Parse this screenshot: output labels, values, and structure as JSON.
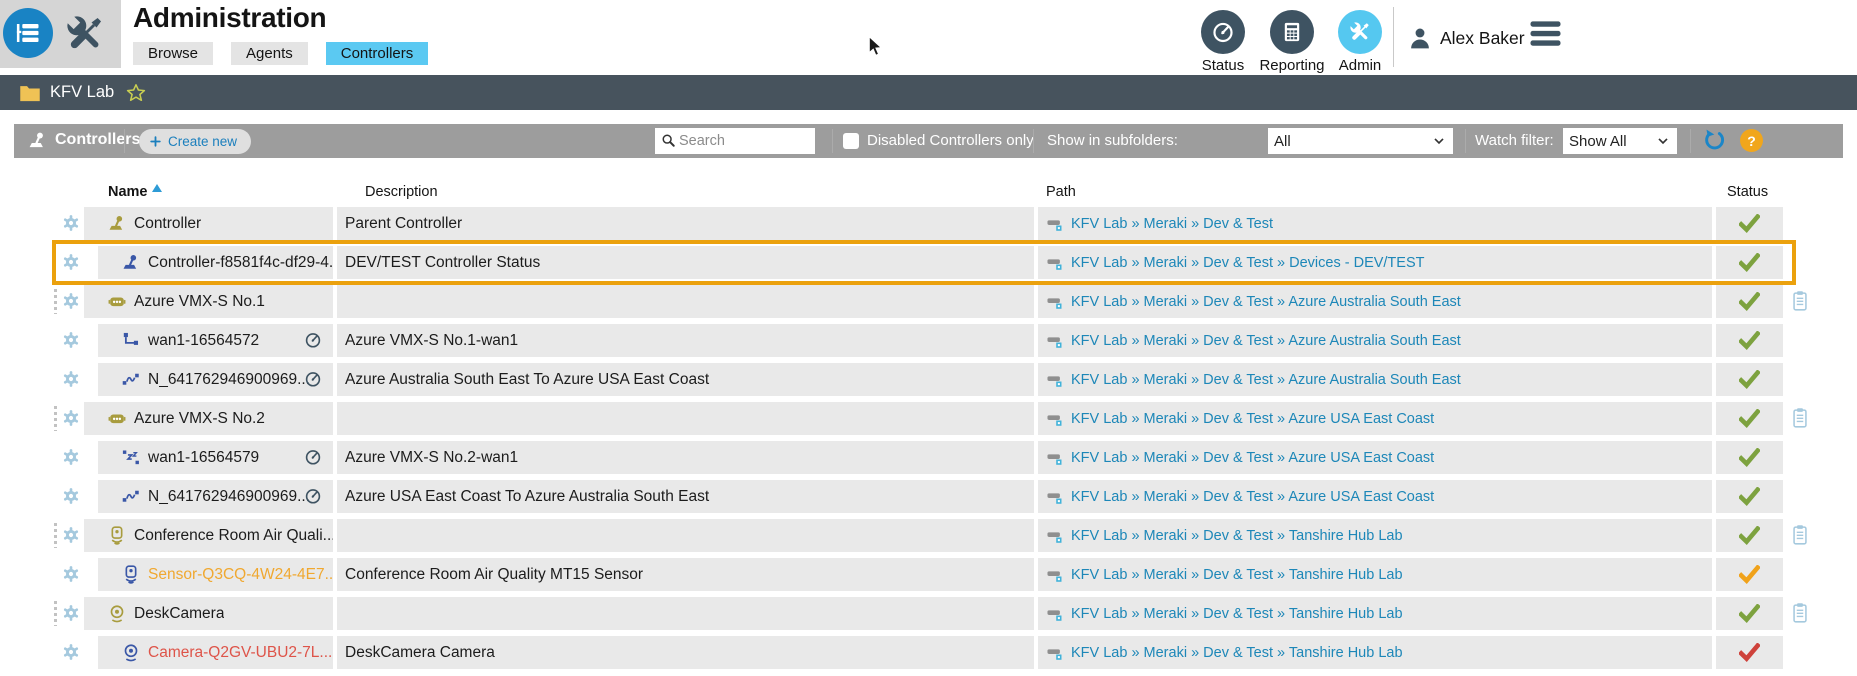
{
  "header": {
    "title": "Administration",
    "tabs": [
      {
        "label": "Browse",
        "active": false
      },
      {
        "label": "Agents",
        "active": false
      },
      {
        "label": "Controllers",
        "active": true
      }
    ],
    "nav": [
      {
        "label": "Status",
        "icon": "gauge",
        "active": false
      },
      {
        "label": "Reporting",
        "icon": "calculator",
        "active": false
      },
      {
        "label": "Admin",
        "icon": "tools",
        "active": true
      }
    ],
    "user_name": "Alex Baker"
  },
  "breadcrumb": {
    "folder_label": "KFV Lab"
  },
  "toolbar": {
    "section_label": "Controllers",
    "create_label": "Create new",
    "search_placeholder": "Search",
    "disabled_only_label": "Disabled Controllers only",
    "disabled_only_checked": false,
    "subfolders_label": "Show in subfolders:",
    "subfolders_value": "All",
    "watch_label": "Watch filter:",
    "watch_value": "Show All",
    "help_label": "?"
  },
  "table": {
    "headers": {
      "name": "Name",
      "description": "Description",
      "path": "Path",
      "status": "Status"
    },
    "sort": {
      "column": "Name",
      "direction": "asc"
    },
    "rows": [
      {
        "name": "Controller",
        "icon": "joystick",
        "icon_color": "olive",
        "level": 0,
        "description": "Parent Controller",
        "path": "KFV Lab » Meraki » Dev & Test",
        "status": "ok",
        "gauge": false,
        "drag": false,
        "clipboard": false,
        "selected": false,
        "name_color": "default"
      },
      {
        "name": "Controller-f8581f4c-df29-4...",
        "icon": "joystick",
        "icon_color": "blue",
        "level": 1,
        "description": "DEV/TEST Controller Status",
        "path": "KFV Lab » Meraki » Dev & Test » Devices - DEV/TEST",
        "status": "ok",
        "gauge": false,
        "drag": false,
        "clipboard": false,
        "selected": true,
        "name_color": "default"
      },
      {
        "name": "Azure VMX-S No.1",
        "icon": "robot",
        "icon_color": "olive",
        "level": 0,
        "description": "",
        "path": "KFV Lab » Meraki » Dev & Test » Azure Australia South East",
        "status": "ok",
        "gauge": false,
        "drag": true,
        "clipboard": true,
        "selected": false,
        "name_color": "default"
      },
      {
        "name": "wan1-16564572",
        "icon": "branch",
        "icon_color": "blue",
        "level": 1,
        "description": "Azure VMX-S No.1-wan1",
        "path": "KFV Lab » Meraki » Dev & Test » Azure Australia South East",
        "status": "ok",
        "gauge": true,
        "drag": false,
        "clipboard": false,
        "selected": false,
        "name_color": "default"
      },
      {
        "name": "N_641762946900969...",
        "icon": "wave",
        "icon_color": "blue",
        "level": 1,
        "description": "Azure Australia South East To Azure USA East Coast",
        "path": "KFV Lab » Meraki » Dev & Test » Azure Australia South East",
        "status": "ok",
        "gauge": true,
        "drag": false,
        "clipboard": false,
        "selected": false,
        "name_color": "default"
      },
      {
        "name": "Azure VMX-S No.2",
        "icon": "robot",
        "icon_color": "olive",
        "level": 0,
        "description": "",
        "path": "KFV Lab » Meraki » Dev & Test » Azure USA East Coast",
        "status": "ok",
        "gauge": false,
        "drag": true,
        "clipboard": true,
        "selected": false,
        "name_color": "default"
      },
      {
        "name": "wan1-16564579",
        "icon": "sleep",
        "icon_color": "blue",
        "level": 1,
        "description": "Azure VMX-S No.2-wan1",
        "path": "KFV Lab » Meraki » Dev & Test » Azure USA East Coast",
        "status": "ok",
        "gauge": true,
        "drag": false,
        "clipboard": false,
        "selected": false,
        "name_color": "default"
      },
      {
        "name": "N_641762946900969...",
        "icon": "wave",
        "icon_color": "blue",
        "level": 1,
        "description": "Azure USA East Coast To Azure Australia South East",
        "path": "KFV Lab » Meraki » Dev & Test » Azure USA East Coast",
        "status": "ok",
        "gauge": true,
        "drag": false,
        "clipboard": false,
        "selected": false,
        "name_color": "default"
      },
      {
        "name": "Conference Room Air Quali...",
        "icon": "sensor",
        "icon_color": "olive",
        "level": 0,
        "description": "",
        "path": "KFV Lab » Meraki » Dev & Test » Tanshire Hub Lab",
        "status": "ok",
        "gauge": false,
        "drag": true,
        "clipboard": true,
        "selected": false,
        "name_color": "default"
      },
      {
        "name": "Sensor-Q3CQ-4W24-4E7...",
        "icon": "sensor",
        "icon_color": "blue",
        "level": 1,
        "description": "Conference Room Air Quality MT15 Sensor",
        "path": "KFV Lab » Meraki » Dev & Test » Tanshire Hub Lab",
        "status": "warning",
        "gauge": false,
        "drag": false,
        "clipboard": false,
        "selected": false,
        "name_color": "warning"
      },
      {
        "name": "DeskCamera",
        "icon": "camera",
        "icon_color": "olive",
        "level": 0,
        "description": "",
        "path": "KFV Lab » Meraki » Dev & Test » Tanshire Hub Lab",
        "status": "ok",
        "gauge": false,
        "drag": true,
        "clipboard": true,
        "selected": false,
        "name_color": "default"
      },
      {
        "name": "Camera-Q2GV-UBU2-7L...",
        "icon": "camera",
        "icon_color": "blue",
        "level": 1,
        "description": "DeskCamera Camera",
        "path": "KFV Lab » Meraki » Dev & Test » Tanshire Hub Lab",
        "status": "error",
        "gauge": false,
        "drag": false,
        "clipboard": false,
        "selected": false,
        "name_color": "error"
      }
    ]
  },
  "colors": {
    "accent_cyan": "#55C8F0",
    "link_blue": "#1D87B8",
    "action_blue": "#1B7FBD",
    "status_ok": "#7DA23F",
    "status_warning": "#F0A21A",
    "status_error": "#CE423B",
    "selection_orange": "#EBA10D",
    "icon_olive": "#A89C3E",
    "icon_blue": "#3A57A7",
    "toolbar_gray": "#9D9D9D",
    "breadcrumb_slate": "#47535D"
  }
}
